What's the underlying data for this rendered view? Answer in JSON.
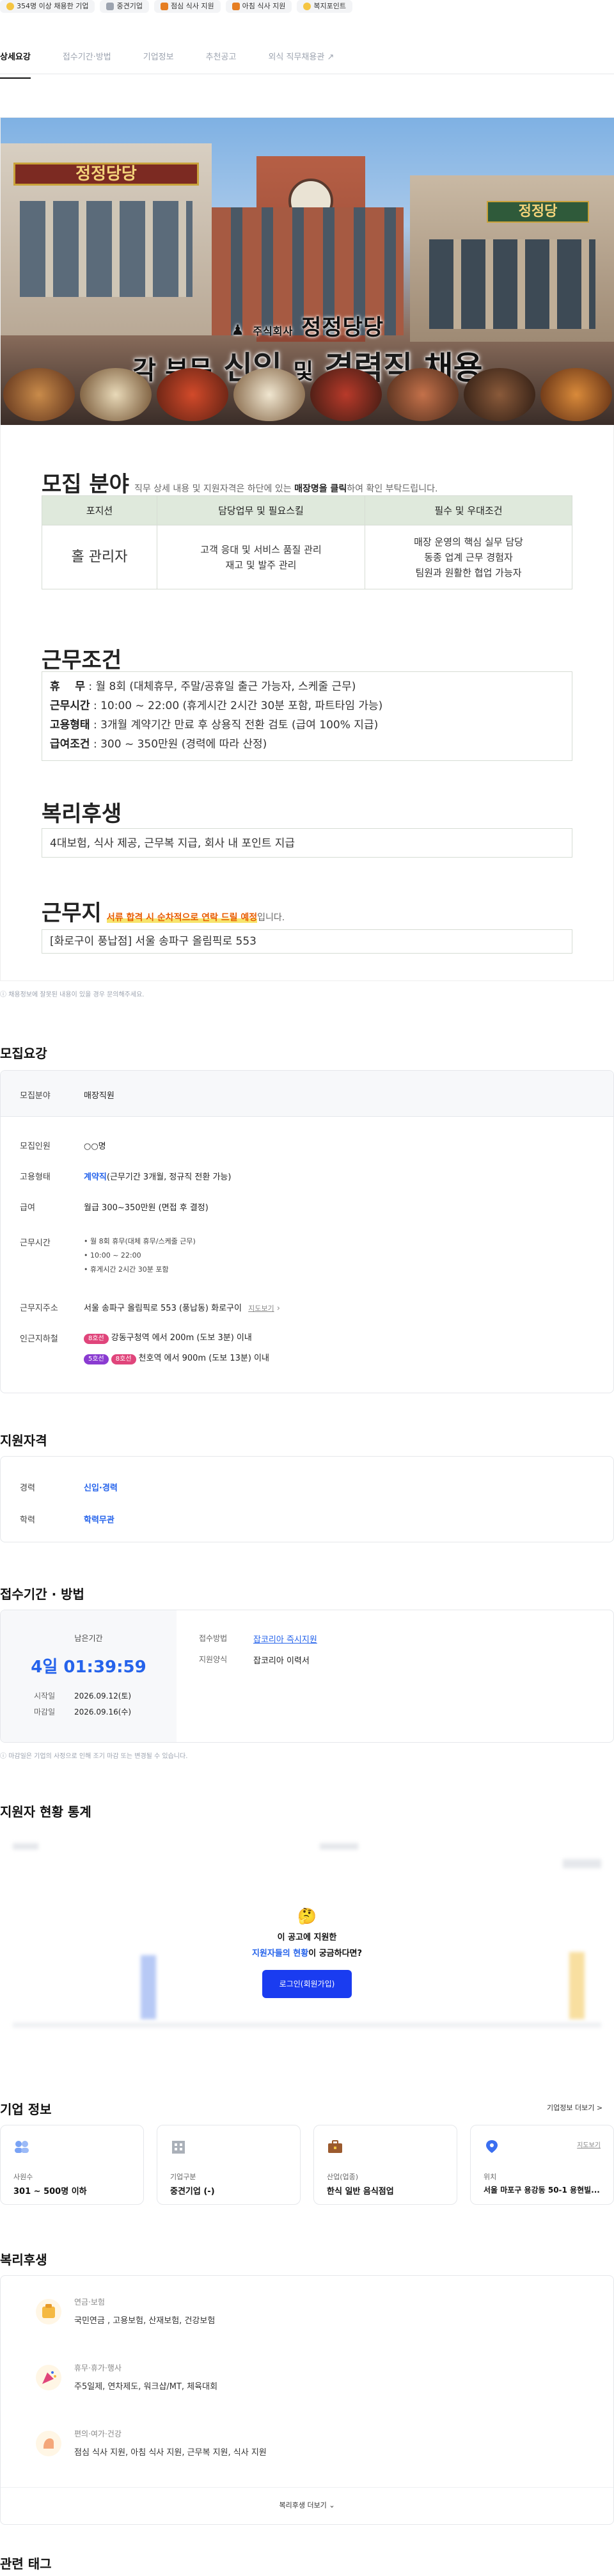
{
  "chips": [
    {
      "label": "354명 이상 채용한 기업",
      "icon": "star-icon",
      "color": "#f5c542"
    },
    {
      "label": "중견기업",
      "icon": "building-icon",
      "color": "#9ca3af"
    },
    {
      "label": "점심 식사 지원",
      "icon": "meal-icon",
      "color": "#e67e22"
    },
    {
      "label": "아침 식사 지원",
      "icon": "meal-icon",
      "color": "#e67e22"
    },
    {
      "label": "복지포인트",
      "icon": "coin-icon",
      "color": "#f5c542"
    }
  ],
  "tabs": [
    "상세요강",
    "접수기간·방법",
    "기업정보",
    "추천공고",
    "외식 직무채용관"
  ],
  "poster": {
    "company": "주식회사 정정당당",
    "company_prefix": "주식회사",
    "company_name": "정정당당",
    "headline_a": "각 부문",
    "headline_b": "신입",
    "headline_c": "및",
    "headline_d": "경력직",
    "headline_e": "채용",
    "sign_left": "정정당당",
    "sign_right": "정정당",
    "recruit_title": "모집 분야",
    "recruit_note_a": "직무 상세 내용 및 지원자격은 하단에 있는",
    "recruit_note_b": "매장명을 클릭",
    "recruit_note_c": "하여 확인 부탁드립니다.",
    "table_headers": [
      "포지션",
      "담당업무 및 필요스킬",
      "필수 및 우대조건"
    ],
    "table_position": "홀 관리자",
    "table_duty_1": "고객 응대 및 서비스 품질 관리",
    "table_duty_2": "재고 및 발주 관리",
    "table_req_1": "매장 운영의 핵심 실무 담당",
    "table_req_2": "동종 업계 근무 경험자",
    "table_req_3": "팀원과 원활한 협업 가능자",
    "cond_title": "근무조건",
    "cond_rows": [
      {
        "k": "휴    무",
        "v": " : 월 8회 (대체휴무, 주말/공휴일 출근 가능자, 스케줄 근무)"
      },
      {
        "k": "근무시간",
        "v": " : 10:00 ~ 22:00 (휴게시간 2시간 30분 포함, 파트타임 가능)"
      },
      {
        "k": "고용형태",
        "v": " : 3개월 계약기간 만료 후 상용직 전환 검토 (급여 100% 지급)"
      },
      {
        "k": "급여조건",
        "v": " : 300 ~ 350만원 (경력에 따라 산정)"
      }
    ],
    "welfare_title": "복리후생",
    "welfare_text": "4대보험, 식사 제공, 근무복 지급, 회사 내 포인트 지급",
    "location_title": "근무지",
    "location_note_hl": "서류 합격 시 순차적으로 연락 드릴 예정",
    "location_note_end": "입니다.",
    "location_text": "[화로구이 풍납점] 서울 송파구 올림픽로 553"
  },
  "report_note": "채용정보에 잘못된 내용이 있을 경우 문의해주세요.",
  "summary": {
    "title": "모집요강",
    "field_label": "모집분야",
    "field_value": "매장직원",
    "count_label": "모집인원",
    "count_value": "○○명",
    "type_label": "고용형태",
    "type_value_bold": "계약직",
    "type_value_rest": "(근무기간 3개월, 정규직 전환 가능)",
    "salary_label": "급여",
    "salary_value": "월급 300~350만원 (면접 후 결정)",
    "hours_label": "근무시간",
    "hours_bullets": [
      "월 8회 휴무(대체 휴무/스케줄 근무)",
      "10:00 ~ 22:00",
      "휴게시간 2시간 30분 포함"
    ],
    "addr_label": "근무지주소",
    "addr_value": "서울 송파구 올림픽로 553 (풍납동) 화로구이",
    "map_link": "지도보기",
    "subway_label": "인근지하철",
    "subway_1_line": "8호선",
    "subway_1_text": "강동구청역 에서 200m (도보 3분) 이내",
    "subway_2_line_a": "5호선",
    "subway_2_line_b": "8호선",
    "subway_2_text": "천호역 에서 900m (도보 13분) 이내"
  },
  "qualification": {
    "title": "지원자격",
    "career_label": "경력",
    "career_value": "신입·경력",
    "edu_label": "학력",
    "edu_value": "학력무관"
  },
  "apply": {
    "title": "접수기간 · 방법",
    "remain_label": "남은기간",
    "remain_value": "4일 01:39:59",
    "start_label": "시작일",
    "start_value": "2026.09.12(토)",
    "end_label": "마감일",
    "end_value": "2026.09.16(수)",
    "method_label": "접수방법",
    "method_value": "잡코리아 즉시지원",
    "form_label": "지원양식",
    "form_value": "잡코리아 이력서",
    "note": "마감일은 기업의 사정으로 인해 조기 마감 또는 변경될 수 있습니다."
  },
  "stats": {
    "title": "지원자 현황 통계",
    "prompt_1": "이 공고에 지원한",
    "prompt_2_hl": "지원자들의 현황",
    "prompt_2_end": "이 궁금하다면?",
    "login_button": "로그인(회원가입)"
  },
  "company": {
    "title": "기업 정보",
    "more": "기업정보 더보기 >",
    "cards": [
      {
        "label": "사원수",
        "value": "301 ~ 500명 이하",
        "icon": "people-icon"
      },
      {
        "label": "기업구분",
        "value": "중견기업 (-)",
        "icon": "building-icon"
      },
      {
        "label": "산업(업종)",
        "value": "한식 일반 음식점업",
        "icon": "briefcase-icon"
      },
      {
        "label": "위치",
        "value": "서울 마포구 용강동 50-1 용현빌...",
        "icon": "location-icon"
      }
    ],
    "map_link": "지도보기"
  },
  "welfare": {
    "title": "복리후생",
    "items": [
      {
        "cat": "연금·보험",
        "val": "국민연금 , 고용보험, 산재보험, 건강보험",
        "icon": "insurance-icon"
      },
      {
        "cat": "휴무·휴가·행사",
        "val": "주5일제, 연차제도, 워크샵/MT, 체육대회",
        "icon": "party-icon"
      },
      {
        "cat": "편의·여가·건강",
        "val": "점심 식사 지원, 아침 식사 지원, 근무복 지원, 식사 지원",
        "icon": "health-icon"
      }
    ],
    "more": "복리후생 더보기"
  },
  "tags": {
    "title": "관련 태그"
  }
}
